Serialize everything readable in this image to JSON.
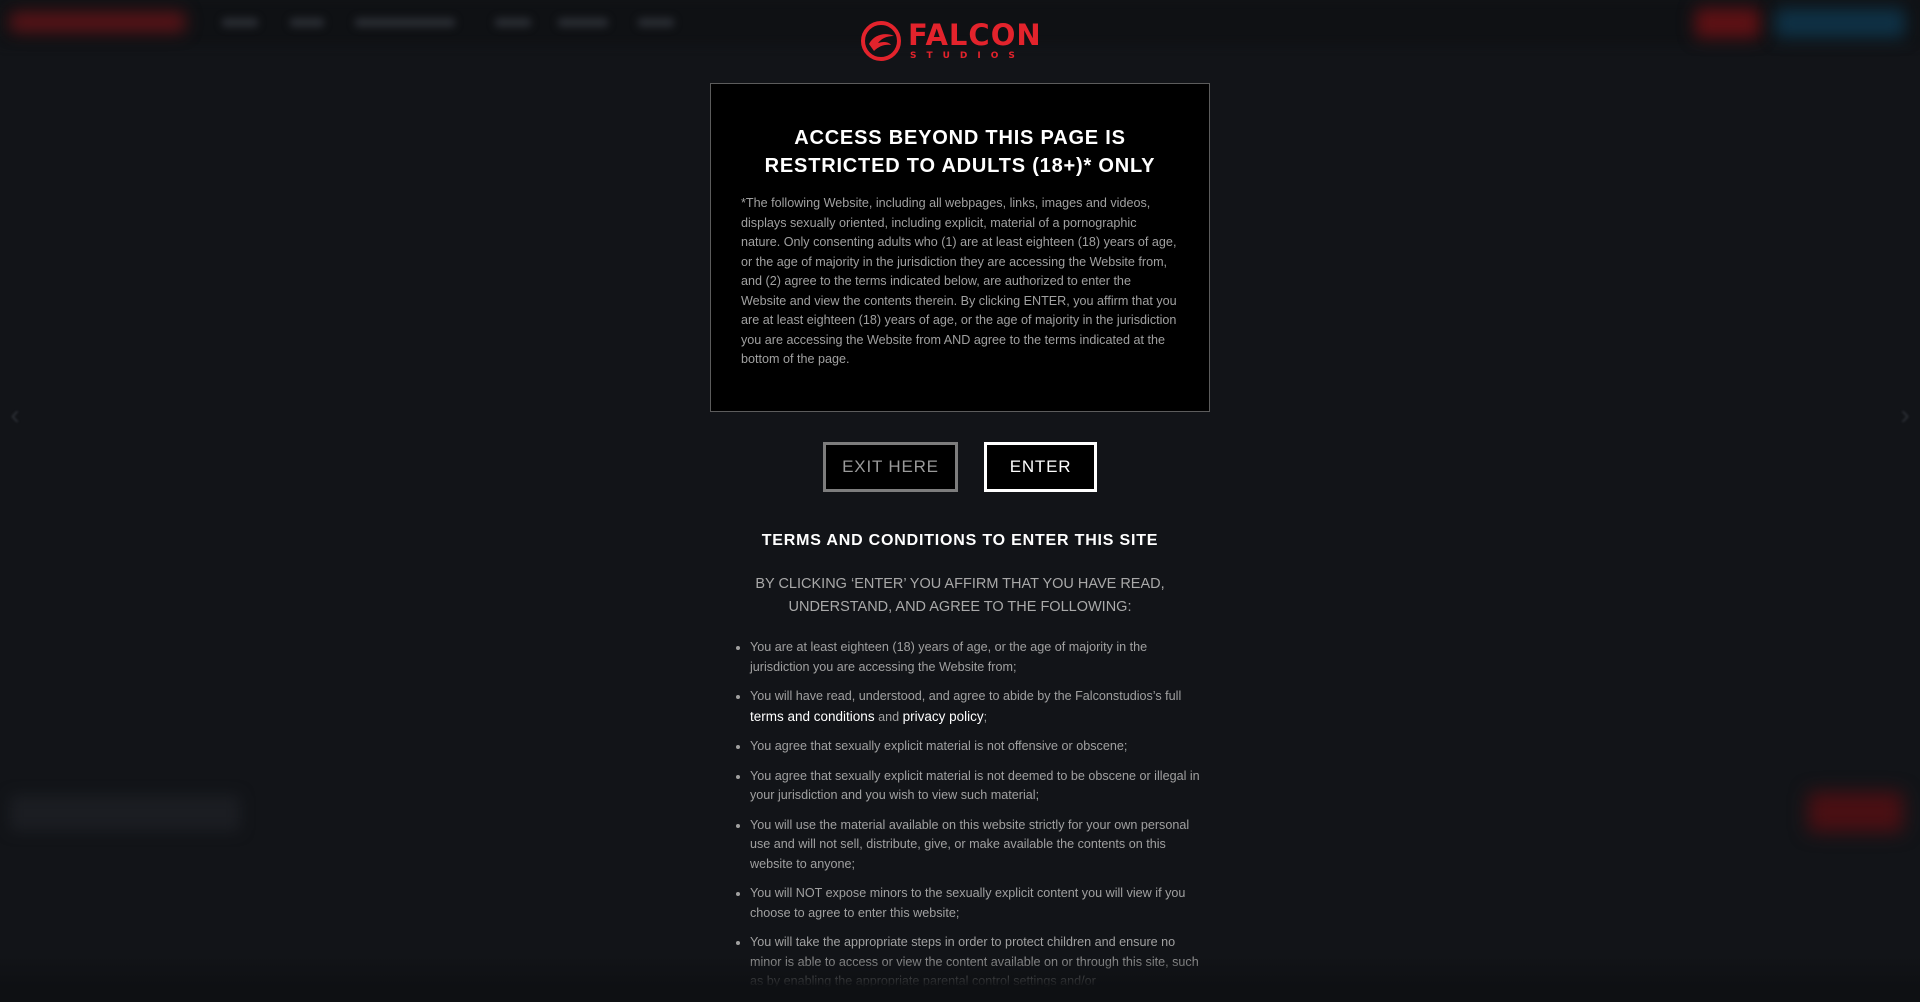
{
  "logo": {
    "word": "FALCON",
    "sub": "STUDIOS",
    "accent_color": "#e3232c"
  },
  "notice": {
    "title_line1": "ACCESS BEYOND THIS PAGE IS",
    "title_line2": "RESTRICTED TO ADULTS (18+)* ONLY",
    "body": "*The following Website, including all webpages, links, images and videos, displays sexually oriented, including explicit, material of a pornographic nature. Only consenting adults who (1) are at least eighteen (18) years of age, or the age of majority in the jurisdiction they are accessing the Website from, and (2) agree to the terms indicated below, are authorized to enter the Website and view the contents therein. By clicking ENTER, you affirm that you are at least eighteen (18) years of age, or the age of majority in the jurisdiction you are accessing the Website from AND agree to the terms indicated at the bottom of the page."
  },
  "buttons": {
    "exit_label": "EXIT HERE",
    "enter_label": "ENTER"
  },
  "terms": {
    "title": "TERMS AND CONDITIONS TO ENTER THIS SITE",
    "intro": "BY CLICKING ‘ENTER’ YOU AFFIRM THAT YOU HAVE READ, UNDERSTAND, AND AGREE TO THE FOLLOWING:",
    "item1": "You are at least eighteen (18) years of age, or the age of majority in the jurisdiction you are accessing the Website from;",
    "item2_prefix": "You will have read, understood, and agree to abide by the Falconstudios’s full ",
    "item2_link1": "terms and conditions",
    "item2_mid": " and ",
    "item2_link2": "privacy policy",
    "item2_suffix": ";",
    "item3": "You agree that sexually explicit material is not offensive or obscene;",
    "item4": "You agree that sexually explicit material is not deemed to be obscene or illegal in your jurisdiction and you wish to view such material;",
    "item5": "You will use the material available on this website strictly for your own personal use and will not sell, distribute, give, or make available the contents on this website to anyone;",
    "item6": "You will NOT expose minors to the sexually explicit content you will view if you choose to agree to enter this website;",
    "item7": "You will take the appropriate steps in order to protect children and ensure no minor is able to access or view the content available on or through this site, such as by enabling the appropriate parental control settings and/or"
  },
  "background": {
    "prev_arrow": "‹",
    "next_arrow": "›"
  }
}
